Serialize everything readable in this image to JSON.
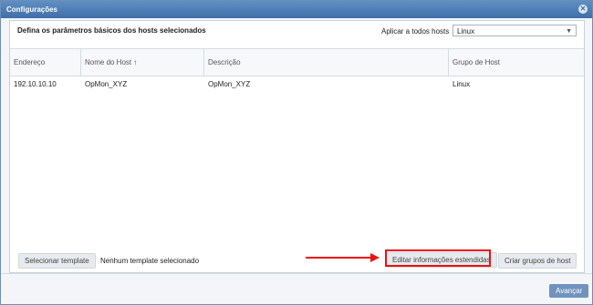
{
  "window": {
    "title": "Configurações"
  },
  "panel": {
    "title": "Defina os parâmetros básicos dos hosts selecionados",
    "apply_all_label": "Aplicar a todos hosts",
    "apply_all_value": "Linux"
  },
  "table": {
    "columns": [
      "Endereço",
      "Nome do Host",
      "Descrição",
      "Grupo de Host"
    ],
    "rows": [
      {
        "address": "192.10.10.10",
        "hostname": "OpMon_XYZ",
        "description": "OpMon_XYZ",
        "group": "Linux"
      }
    ]
  },
  "footer": {
    "select_template": "Selecionar template",
    "template_status": "Nenhum template selecionado",
    "edit_extended": "Editar informações estendidas",
    "create_groups": "Criar grupos de host",
    "next": "Avançar"
  },
  "colors": {
    "titlebar": "#4a7bb3",
    "highlight": "#ee1111",
    "primary_button": "#6f93bd"
  },
  "icons": {
    "close": "close-icon",
    "sort": "sort-arrow-icon",
    "dropdown": "chevron-down-icon"
  }
}
